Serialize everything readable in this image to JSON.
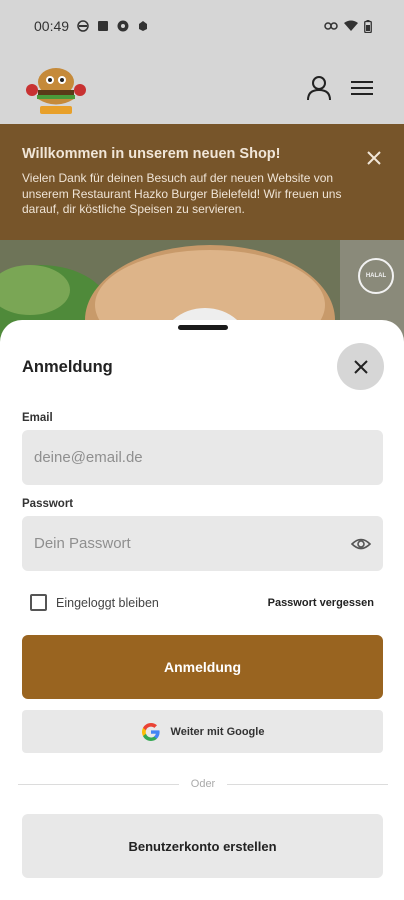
{
  "status_bar": {
    "time": "00:49"
  },
  "banner": {
    "title": "Willkommen in unserem neuen Shop!",
    "text": "Vielen Dank für deinen Besuch auf der neuen Website von unserem Restaurant Hazko Burger Bielefeld! Wir freuen uns darauf, dir köstliche Speisen zu servieren."
  },
  "hero": {
    "badge_label": "HALAL"
  },
  "sheet": {
    "title": "Anmeldung",
    "email": {
      "label": "Email",
      "placeholder": "deine@email.de",
      "value": ""
    },
    "password": {
      "label": "Passwort",
      "placeholder": "Dein Passwort",
      "value": ""
    },
    "remember_label": "Eingeloggt bleiben",
    "remember_checked": false,
    "forgot_label": "Passwort vergessen",
    "login_button": "Anmeldung",
    "google_button": "Weiter mit Google",
    "divider_text": "Oder",
    "register_button": "Benutzerkonto erstellen"
  },
  "colors": {
    "accent": "#996420",
    "banner_bg": "#77552a",
    "input_bg": "#e8e8e8",
    "header_bg": "#d6d6d6"
  },
  "icons": [
    "user-icon",
    "menu-icon",
    "close-icon",
    "eye-icon",
    "google-icon",
    "wifi-icon",
    "battery-icon"
  ]
}
